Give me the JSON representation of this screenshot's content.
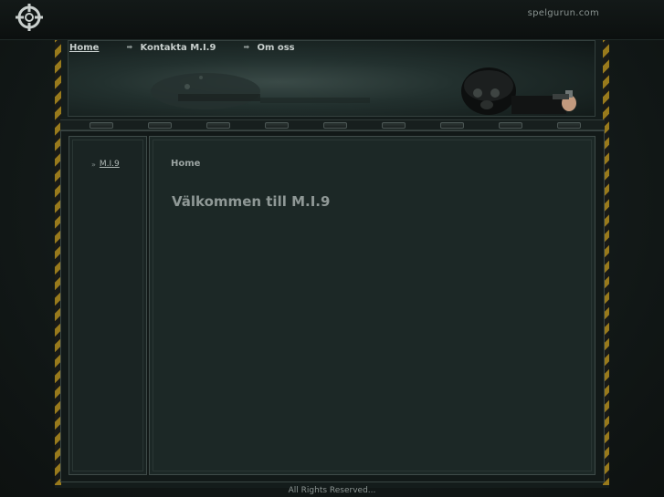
{
  "site": {
    "domain": "spelgurun.com"
  },
  "nav": {
    "items": [
      {
        "label": "Home"
      },
      {
        "label": "Kontakta M.I.9"
      },
      {
        "label": "Om oss"
      }
    ]
  },
  "sidebar": {
    "items": [
      {
        "label": "M.I.9"
      }
    ]
  },
  "main": {
    "breadcrumb": "Home",
    "heading": "Välkommen till M.I.9"
  },
  "footer": {
    "text": "All Rights Reserved..."
  },
  "icons": {
    "logo": "crosshair-icon",
    "nav_arrow": "arrow-right-icon",
    "sidebar_arrow": "double-arrow-icon"
  },
  "colors": {
    "background": "#131a19",
    "panel": "#1c2826",
    "hazard_stripe": "#b08a1c",
    "text": "#c8cfcd"
  }
}
